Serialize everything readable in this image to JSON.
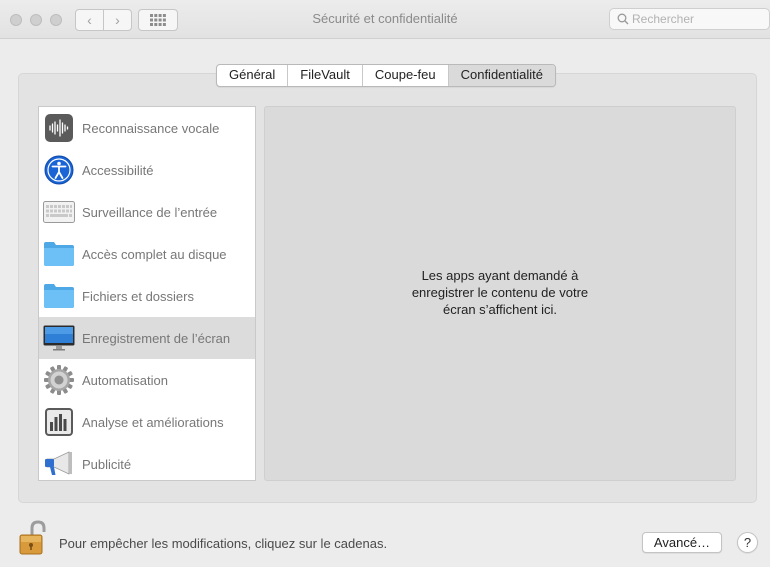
{
  "window": {
    "title": "Sécurité et confidentialité",
    "back_glyph": "‹",
    "forward_glyph": "›"
  },
  "search": {
    "placeholder": "Rechercher",
    "value": ""
  },
  "tabs": [
    {
      "label": "Général",
      "active": false
    },
    {
      "label": "FileVault",
      "active": false
    },
    {
      "label": "Coupe-feu",
      "active": false
    },
    {
      "label": "Confidentialité",
      "active": true
    }
  ],
  "sidebar": {
    "items": [
      {
        "label": "Reconnaissance vocale",
        "icon": "waveform-icon",
        "selected": false
      },
      {
        "label": "Accessibilité",
        "icon": "accessibility-icon",
        "selected": false
      },
      {
        "label": "Surveillance de l’entrée",
        "icon": "keyboard-icon",
        "selected": false
      },
      {
        "label": "Accès complet au disque",
        "icon": "folder-icon",
        "selected": false
      },
      {
        "label": "Fichiers et dossiers",
        "icon": "folder-icon",
        "selected": false
      },
      {
        "label": "Enregistrement de l’écran",
        "icon": "display-icon",
        "selected": true
      },
      {
        "label": "Automatisation",
        "icon": "gear-icon",
        "selected": false
      },
      {
        "label": "Analyse et améliorations",
        "icon": "bar-chart-icon",
        "selected": false
      },
      {
        "label": "Publicité",
        "icon": "megaphone-icon",
        "selected": false
      }
    ]
  },
  "panel": {
    "message_lines": [
      "Les apps ayant demandé à",
      "enregistrer le contenu de votre",
      "écran s’affichent ici."
    ]
  },
  "footer": {
    "lock_text": "Pour empêcher les modifications, cliquez sur le cadenas.",
    "advanced_label": "Avancé…",
    "help_label": "?"
  },
  "colors": {
    "folder_blue": "#5fb6f0",
    "accessibility_blue": "#1a64d6",
    "lock_gold": "#d89a3a"
  }
}
